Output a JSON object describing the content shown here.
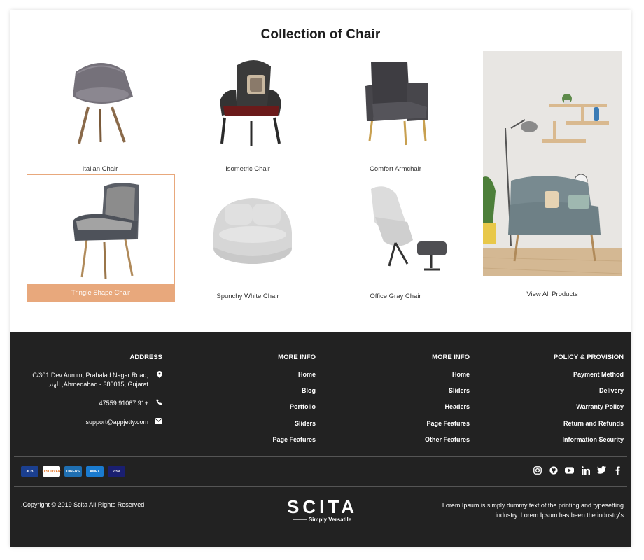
{
  "section": {
    "title": "Collection of Chair"
  },
  "products": [
    {
      "name": "Italian Chair",
      "icon": "italian-chair-image"
    },
    {
      "name": "Isometric Chair",
      "icon": "isometric-chair-image"
    },
    {
      "name": "Comfort Armchair",
      "icon": "comfort-armchair-image"
    },
    {
      "name": "Tringle Shape Chair",
      "icon": "tringle-shape-chair-image",
      "active": true
    },
    {
      "name": "Spunchy White Chair",
      "icon": "spunchy-white-chair-image"
    },
    {
      "name": "Office Gray Chair",
      "icon": "office-gray-chair-image"
    }
  ],
  "view_all": "View All Products",
  "footer": {
    "address": {
      "heading": "ADDRESS",
      "line1": "C/301 Dev Aurum, Prahalad Nagar Road,",
      "line2": "الهند ,Ahmedabad - 380015, Gujarat",
      "phone": "47559 91067 91+",
      "email": "support@appjetty.com"
    },
    "more_info_1": {
      "heading": "MORE INFO",
      "links": [
        "Home",
        "Blog",
        "Portfolio",
        "Sliders",
        "Page Features"
      ]
    },
    "more_info_2": {
      "heading": "MORE INFO",
      "links": [
        "Home",
        "Sliders",
        "Headers",
        "Page Features",
        "Other Features"
      ]
    },
    "policy": {
      "heading": "POLICY & PROVISION",
      "links": [
        "Payment Method",
        "Delivery",
        "Warranty Policy",
        "Return and Refunds",
        "Information Security"
      ]
    },
    "payment_cards": [
      "JCB",
      "DISCOVER",
      "DINERS",
      "AMEX",
      "VISA"
    ],
    "social": [
      "instagram-icon",
      "github-icon",
      "youtube-icon",
      "linkedin-icon",
      "twitter-icon",
      "facebook-icon"
    ],
    "copyright": ".Copyright © 2019 Scita All Rights Reserved",
    "brand_name": "SCITA",
    "brand_tagline": "Simply Versatile",
    "lorem_line1": "Lorem Ipsum is simply dummy text of the printing and typesetting",
    "lorem_line2": ".industry. Lorem Ipsum has been the industry's"
  },
  "colors": {
    "accent": "#e8a87c",
    "footer_bg": "#222222"
  }
}
